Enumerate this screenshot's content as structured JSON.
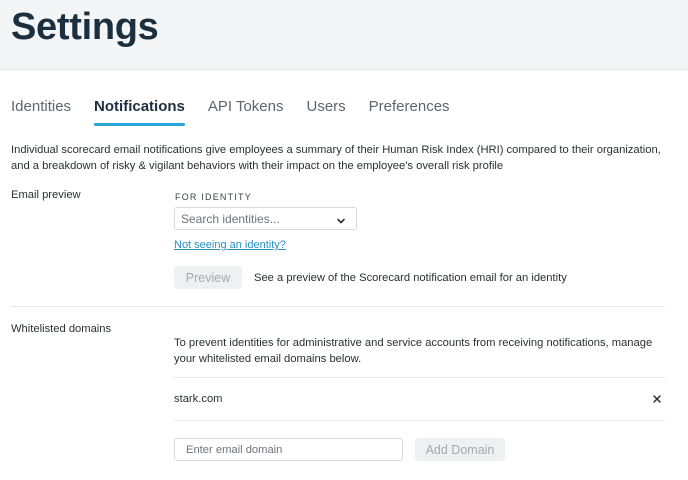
{
  "header": {
    "title": "Settings"
  },
  "tabs": [
    {
      "label": "Identities",
      "active": false
    },
    {
      "label": "Notifications",
      "active": true
    },
    {
      "label": "API Tokens",
      "active": false
    },
    {
      "label": "Users",
      "active": false
    },
    {
      "label": "Preferences",
      "active": false
    }
  ],
  "intro": "Individual scorecard email notifications give employees a summary of their Human Risk Index (HRI) compared to their organization, and a breakdown of risky & vigilant behaviors with their impact on the employee's overall risk profile",
  "email_preview": {
    "label": "Email preview",
    "for_identity_label": "FOR IDENTITY",
    "search_placeholder": "Search identities...",
    "not_seeing_link": "Not seeing an identity?",
    "preview_button": "Preview",
    "preview_helper": "See a preview of the Scorecard notification email for an identity"
  },
  "whitelisted": {
    "label": "Whitelisted domains",
    "description": "To prevent identities for administrative and service accounts from receiving notifications, manage your whitelisted email domains below.",
    "domains": [
      "stark.com"
    ],
    "input_placeholder": "Enter email domain",
    "add_button": "Add Domain"
  },
  "colors": {
    "accent": "#2aa5d8",
    "title": "#1b2f3e",
    "link": "#2a8fc4"
  }
}
